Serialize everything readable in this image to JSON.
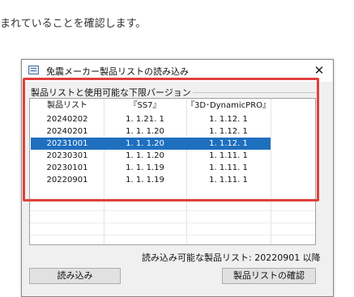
{
  "intro_text": "まれていることを確認します。",
  "dialog": {
    "title": "免震メーカー製品リストの読み込み",
    "close_glyph": "✕",
    "group_label": "製品リストと使用可能な下限バージョン",
    "columns": [
      "製品リスト",
      "『SS7』",
      "『3D･DynamicPRO』"
    ],
    "rows": [
      [
        "20240202",
        "1. 1.21. 1",
        "1. 1.12. 1"
      ],
      [
        "20240201",
        "1. 1. 1.20",
        "1. 1.12. 1"
      ],
      [
        "20231001",
        "1. 1. 1.20",
        "1. 1.12. 1"
      ],
      [
        "20230301",
        "1. 1. 1.20",
        "1. 1.11. 1"
      ],
      [
        "20230101",
        "1. 1. 1.19",
        "1. 1.11. 1"
      ],
      [
        "20220901",
        "1. 1. 1.19",
        "1. 1.11. 1"
      ]
    ],
    "selected_row": 2,
    "supported_text": "読み込み可能な製品リスト: 20220901 以降",
    "load_button": "読み込み",
    "check_button": "製品リストの確認"
  },
  "colors": {
    "highlight": "#e0403c",
    "selection": "#1f6fbf"
  }
}
